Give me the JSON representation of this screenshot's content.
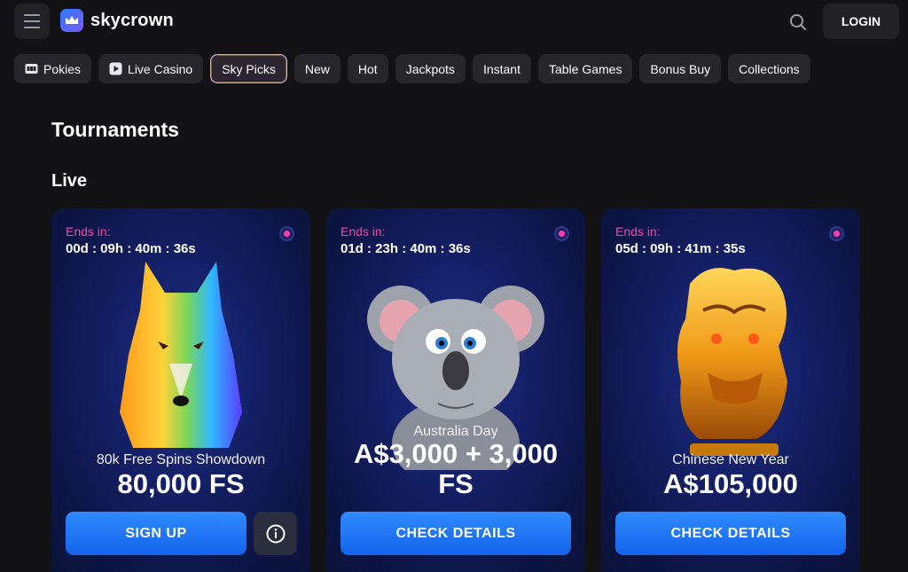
{
  "header": {
    "brand": "skycrown",
    "login_label": "LOGIN",
    "icons": {
      "menu": "hamburger-menu-icon",
      "search": "search-icon",
      "logo": "crown-logo-icon"
    }
  },
  "categories": [
    {
      "label": "Pokies",
      "icon": "slot-machine-icon"
    },
    {
      "label": "Live Casino",
      "icon": "play-icon"
    },
    {
      "label": "Sky Picks",
      "active": true
    },
    {
      "label": "New"
    },
    {
      "label": "Hot"
    },
    {
      "label": "Jackpots"
    },
    {
      "label": "Instant"
    },
    {
      "label": "Table Games"
    },
    {
      "label": "Bonus Buy"
    },
    {
      "label": "Collections"
    }
  ],
  "page": {
    "title": "Tournaments",
    "section": "Live"
  },
  "tournaments": [
    {
      "ends_label": "Ends in:",
      "timer": "00d : 09h : 40m : 36s",
      "name": "80k Free Spins Showdown",
      "prize": "80,000 FS",
      "button": "SIGN UP",
      "has_info": true,
      "art": "rainbow-wolf"
    },
    {
      "ends_label": "Ends in:",
      "timer": "01d : 23h : 40m : 36s",
      "name": "Australia Day",
      "prize_line1": "A$3,000 + 3,000",
      "prize_line2": "FS",
      "button": "CHECK DETAILS",
      "art": "koala"
    },
    {
      "ends_label": "Ends in:",
      "timer": "05d : 09h : 41m : 35s",
      "name": "Chinese New Year",
      "prize": "A$105,000",
      "button": "CHECK DETAILS",
      "art": "golden-dragon"
    }
  ],
  "colors": {
    "accent_blue": "#1f7bff",
    "timer_pink": "#ff3fa8",
    "bg": "#121214"
  }
}
